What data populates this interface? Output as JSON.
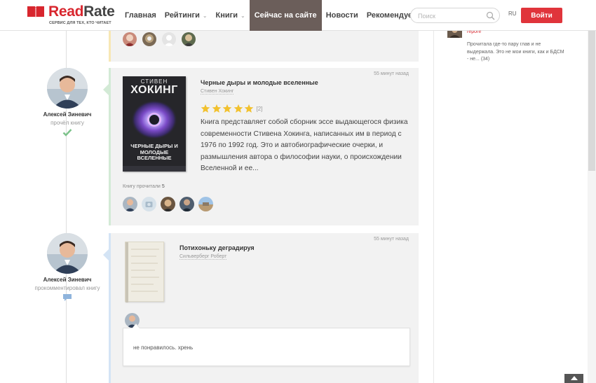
{
  "header": {
    "logo_name_first": "Read",
    "logo_name_second": "Rate",
    "logo_tagline": "СЕРВИС ДЛЯ ТЕХ, КТО ЧИТАЕТ",
    "nav": [
      {
        "label": "Главная"
      },
      {
        "label": "Рейтинги"
      },
      {
        "label": "Книги"
      },
      {
        "label": "Сейчас на сайте"
      },
      {
        "label": "Новости"
      },
      {
        "label": "Рекомендуем"
      }
    ],
    "search_placeholder": "Поиск",
    "lang": "RU",
    "login_label": "Войти"
  },
  "feed": [
    {
      "user": "Алексей Зиневич",
      "action": "прочёл книгу",
      "time": "55 минут назад",
      "book": {
        "title": "Черные дыры и молодые вселенные",
        "author": "Стивен Хокинг",
        "cover_author": "СТИВЕН",
        "cover_name": "ХОКИНГ",
        "cover_title": "ЧЕРНЫЕ ДЫРЫ И МОЛОДЫЕ ВСЕЛЕННЫЕ"
      },
      "rating": 5,
      "rating_count": "[2]",
      "description": "Книга представляет собой сборник эссе выдающегося физика современности Стивена Хокинга, написанных им в период с 1976 по 1992 год. Это и автобиографические очерки, и размышления автора о философии науки, о происхождении Вселенной и ее...",
      "readers_label": "Книгу прочитали",
      "readers_count": "5"
    },
    {
      "user": "Алексей Зиневич",
      "action": "прокомментировал книгу",
      "time": "55 минут назад",
      "book": {
        "title": "Потихоньку деградируя",
        "author": "Сильверберг Роберт"
      },
      "comment": "не понравилось. хрень"
    }
  ],
  "sidebar": {
    "link": "героге",
    "text": "Прочитала где-то пару глав и не выдержала. Это не мои книги, как и БДСМ - не... (34)"
  },
  "colors": {
    "brand": "#d8262e",
    "nav_active": "#6b5e5a",
    "star": "#f2c12e",
    "read_check": "#7cc28a",
    "comment_icon": "#8fb4dc"
  }
}
